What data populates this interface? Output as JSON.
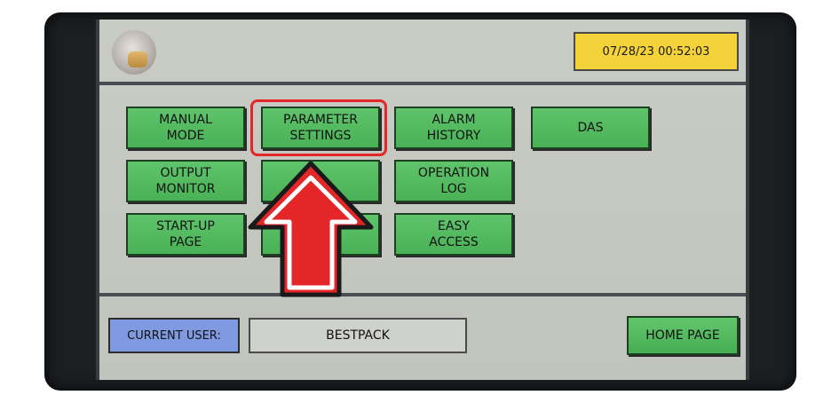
{
  "header": {
    "datetime": "07/28/23 00:52:03"
  },
  "menu": {
    "manual_mode": "MANUAL\nMODE",
    "parameter_settings": "PARAMETER\nSETTINGS",
    "alarm_history": "ALARM\nHISTORY",
    "das": "DAS",
    "output_monitor": "OUTPUT\nMONITOR",
    "operation_log": "OPERATION\nLOG",
    "startup_page": "START-UP\nPAGE",
    "easy_access": "EASY\nACCESS"
  },
  "footer": {
    "current_user_label": "CURRENT USER:",
    "current_user_value": "BESTPACK",
    "home_page": "HOME PAGE"
  },
  "colors": {
    "button_green": "#52b85f",
    "datetime_yellow": "#f4d23a",
    "user_label_blue": "#7f9ae0",
    "highlight_red": "#e52629"
  }
}
